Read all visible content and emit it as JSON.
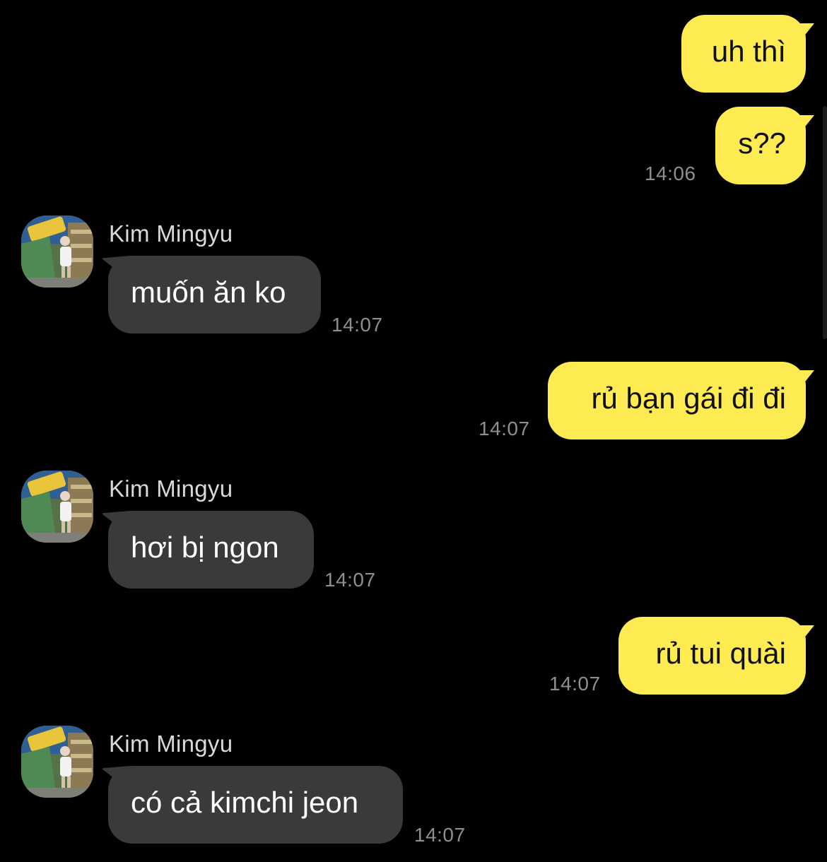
{
  "colors": {
    "background": "#000000",
    "outgoing_bubble": "#FEEB51",
    "incoming_bubble": "#3A3A3C",
    "timestamp": "#8E8E93",
    "sender_name": "#D9D9D9"
  },
  "messages": [
    {
      "direction": "outgoing",
      "text": "uh thì",
      "time": ""
    },
    {
      "direction": "outgoing",
      "text": "s??",
      "time": "14:06"
    },
    {
      "direction": "incoming",
      "sender": "Kim Mingyu",
      "avatar_icon": "profile-photo-icon",
      "text": "muốn ăn ko",
      "time": "14:07"
    },
    {
      "direction": "outgoing",
      "text": "rủ bạn gái đi đi",
      "time": "14:07"
    },
    {
      "direction": "incoming",
      "sender": "Kim Mingyu",
      "avatar_icon": "profile-photo-icon",
      "text": "hơi bị ngon",
      "time": "14:07"
    },
    {
      "direction": "outgoing",
      "text": "rủ tui quài",
      "time": "14:07"
    },
    {
      "direction": "incoming",
      "sender": "Kim Mingyu",
      "avatar_icon": "profile-photo-icon",
      "text": "có cả kimchi jeon",
      "time": "14:07"
    }
  ]
}
